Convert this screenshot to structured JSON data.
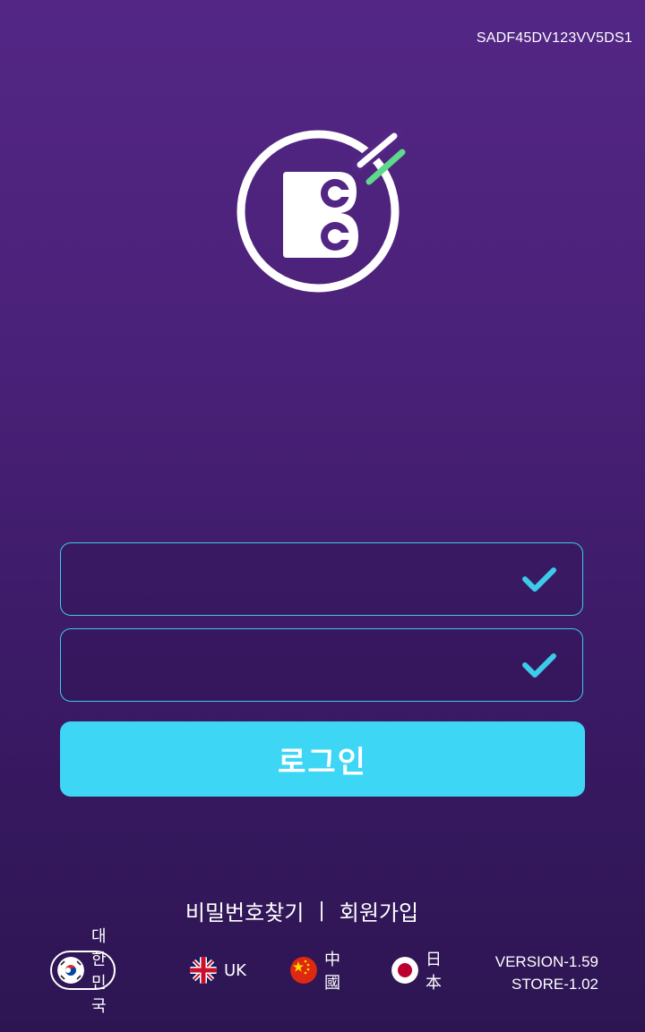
{
  "device_id": "SADF45DV123VV5DS1",
  "login_form": {
    "id_field": {
      "value": "",
      "placeholder": ""
    },
    "password_field": {
      "value": "",
      "placeholder": ""
    },
    "login_label": "로그인"
  },
  "links": {
    "find_password": "비밀번호찾기",
    "separator": "|",
    "sign_up": "회원가입"
  },
  "languages": [
    {
      "label": "대한민국",
      "flag": "korea-flag-icon",
      "selected": true
    },
    {
      "label": "UK",
      "flag": "uk-flag-icon",
      "selected": false
    },
    {
      "label": "中國",
      "flag": "china-flag-icon",
      "selected": false
    },
    {
      "label": "日本",
      "flag": "japan-flag-icon",
      "selected": false
    }
  ],
  "version": {
    "app": "VERSION-1.59",
    "store": "STORE-1.02"
  },
  "colors": {
    "background_top": "#532685",
    "background_bottom": "#2d1552",
    "accent": "#3dd6f5",
    "field_border": "#3ccbe8",
    "logo_green": "#5ed88a"
  }
}
